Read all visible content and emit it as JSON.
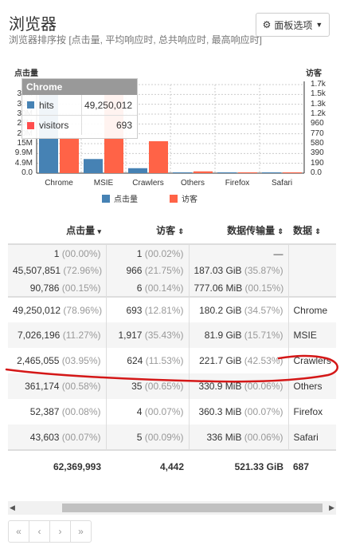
{
  "header": {
    "title": "浏览器",
    "subtitle": "浏览器排序按 [点击量, 平均响应时, 总共响应时, 最高响应时]",
    "panel_options_label": "面板选项"
  },
  "chart_data": {
    "type": "bar",
    "categories": [
      "Chrome",
      "MSIE",
      "Crawlers",
      "Others",
      "Firefox",
      "Safari"
    ],
    "series": [
      {
        "name": "点击量",
        "axis": "left",
        "color": "#4682b4",
        "values": [
          49250012,
          7026196,
          2465055,
          361174,
          52387,
          43603
        ]
      },
      {
        "name": "访客",
        "axis": "right",
        "color": "#ff6347",
        "values": [
          693,
          1917,
          624,
          35,
          4,
          5
        ]
      }
    ],
    "left_axis": {
      "title": "点击量",
      "ticks": [
        "0.0",
        "4.9M",
        "9.9M",
        "15M",
        "20M",
        "25M",
        "30M",
        "35M",
        "39M",
        "44"
      ],
      "max": 44000000
    },
    "right_axis": {
      "title": "访客",
      "ticks": [
        "0.0",
        "190",
        "390",
        "580",
        "770",
        "960",
        "1.2k",
        "1.3k",
        "1.5k",
        "1.7k"
      ],
      "max": 1730
    },
    "legend": [
      "点击量",
      "访客"
    ],
    "grid": true
  },
  "tooltip": {
    "title": "Chrome",
    "rows": [
      {
        "label": "hits",
        "value": "49,250,012",
        "color": "#4682b4"
      },
      {
        "label": "visitors",
        "value": "693",
        "color": "#ff4d4d"
      }
    ]
  },
  "table": {
    "headers": [
      {
        "label": "点击量",
        "sort": "▾"
      },
      {
        "label": "访客",
        "sort": "⇕"
      },
      {
        "label": "数据传输量",
        "sort": "⇕"
      },
      {
        "label": "数据",
        "sort": "⇕"
      }
    ],
    "top_rows": [
      [
        "1",
        "(00.00%)",
        "1",
        "(00.02%)",
        "—",
        "",
        "—"
      ],
      [
        "45,507,851",
        "(72.96%)",
        "966",
        "(21.75%)",
        "187.03 GiB",
        "(35.87%)",
        "—"
      ],
      [
        "90,786",
        "(00.15%)",
        "6",
        "(00.14%)",
        "777.06 MiB",
        "(00.15%)",
        "—"
      ]
    ],
    "rows": [
      [
        "49,250,012",
        "(78.96%)",
        "693",
        "(12.81%)",
        "180.2 GiB",
        "(34.57%)",
        "Chrome"
      ],
      [
        "7,026,196",
        "(11.27%)",
        "1,917",
        "(35.43%)",
        "81.9 GiB",
        "(15.71%)",
        "MSIE"
      ],
      [
        "2,465,055",
        "(03.95%)",
        "624",
        "(11.53%)",
        "221.7 GiB",
        "(42.53%)",
        "Crawlers"
      ],
      [
        "361,174",
        "(00.58%)",
        "35",
        "(00.65%)",
        "330.9 MiB",
        "(00.06%)",
        "Others"
      ],
      [
        "52,387",
        "(00.08%)",
        "4",
        "(00.07%)",
        "360.3 MiB",
        "(00.07%)",
        "Firefox"
      ],
      [
        "43,603",
        "(00.07%)",
        "5",
        "(00.09%)",
        "336 MiB",
        "(00.06%)",
        "Safari"
      ]
    ],
    "totals": [
      "62,369,993",
      "4,442",
      "521.33 GiB",
      "687"
    ]
  },
  "pagination": {
    "first": "«",
    "prev": "‹",
    "next": "›",
    "last": "»"
  },
  "scrollbar": {
    "left_arrow": "◀",
    "right_arrow": "▶"
  },
  "icons": {
    "gear": "gear-icon",
    "caret": "caret-down-icon"
  }
}
